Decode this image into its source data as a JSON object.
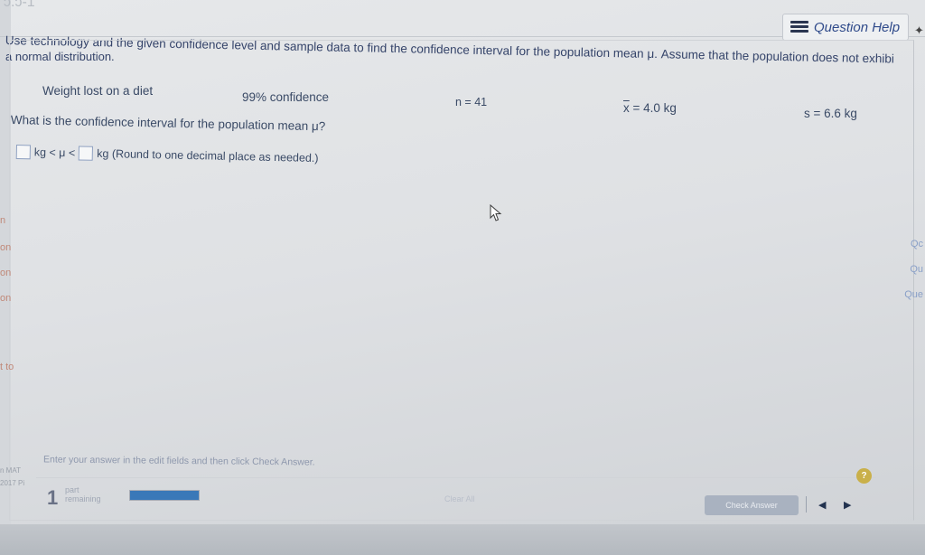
{
  "header": {
    "top_fragment": "ɔ.ɔ-1",
    "help_button_label": "Question Help",
    "help_icon": "list-icon"
  },
  "instructions": {
    "line1": "Use technology and the given confidence level and sample data to find the confidence interval for the population mean μ. Assume that the population does not exhibi",
    "line2": "a normal distribution."
  },
  "data": {
    "topic": "Weight lost on a diet",
    "confidence": "99% confidence",
    "n": "n = 41",
    "xbar_symbol": "x",
    "xbar_rest": " = 4.0 kg",
    "s": "s = 6.6 kg"
  },
  "question": {
    "text": "What is the confidence interval for the population mean μ?",
    "mid_text": "kg < μ <",
    "tail_text": "kg (Round to one decimal place as needed.)",
    "lower_value": "",
    "upper_value": ""
  },
  "side_fragments": {
    "left": [
      "n",
      "on",
      "on",
      "on",
      "t to",
      "n MAT",
      "2017 Pi"
    ],
    "right": [
      "Qc",
      "Qu",
      "Que"
    ]
  },
  "footer": {
    "hint": "Enter your answer in the edit fields and then click Check Answer.",
    "parts_number": "1",
    "parts_line1": "part",
    "parts_line2": "remaining",
    "progress_fraction": 1.0,
    "clear_label": "Clear All",
    "check_label": "Check Answer",
    "help_symbol": "?",
    "prev_symbol": "◀",
    "next_symbol": "▶"
  }
}
